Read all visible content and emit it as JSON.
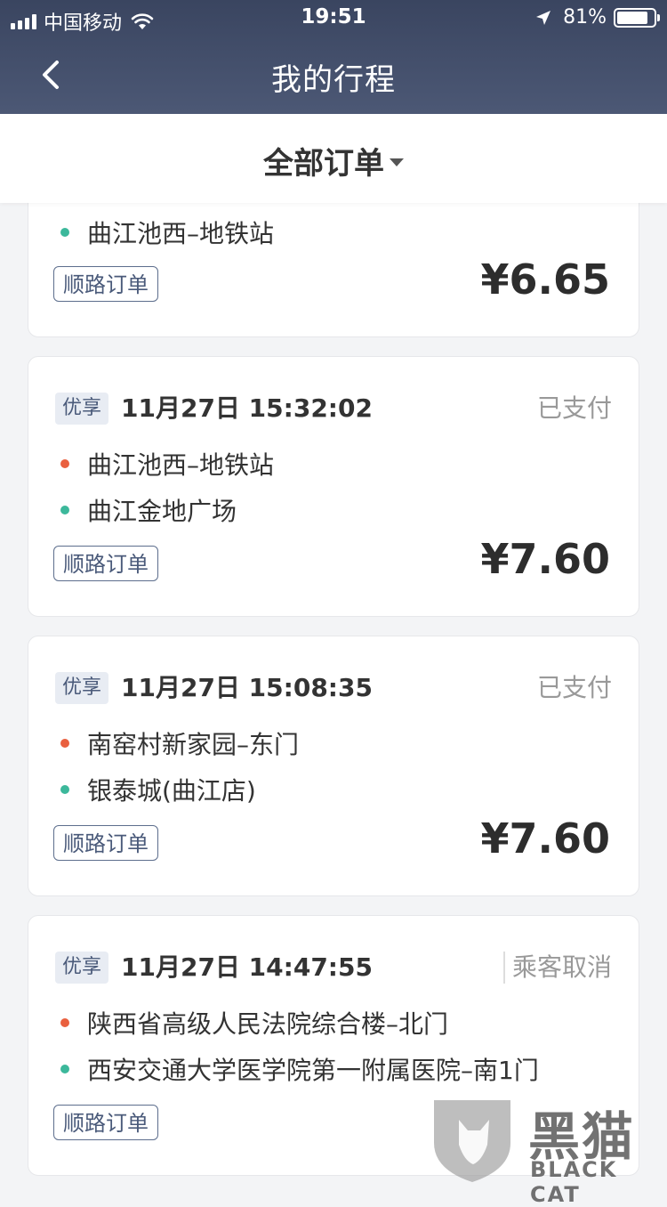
{
  "status_bar": {
    "carrier": "中国移动",
    "time": "19:51",
    "battery": "81%"
  },
  "nav": {
    "title": "我的行程"
  },
  "filter": {
    "label": "全部订单"
  },
  "orders": [
    {
      "stops": [
        "曲江池西–地铁站"
      ],
      "route_tag": "顺路订单",
      "price": "¥6.65"
    },
    {
      "tag": "优享",
      "time": "11月27日 15:32:02",
      "status": "已支付",
      "stops": [
        "曲江池西–地铁站",
        "曲江金地广场"
      ],
      "route_tag": "顺路订单",
      "price": "¥7.60"
    },
    {
      "tag": "优享",
      "time": "11月27日 15:08:35",
      "status": "已支付",
      "stops": [
        "南窑村新家园–东门",
        "银泰城(曲江店)"
      ],
      "route_tag": "顺路订单",
      "price": "¥7.60"
    },
    {
      "tag": "优享",
      "time": "11月27日 14:47:55",
      "status": "乘客取消",
      "stops": [
        "陕西省高级人民法院综合楼–北门",
        "西安交通大学医学院第一附属医院–南1门"
      ],
      "route_tag": "顺路订单"
    }
  ],
  "watermark": {
    "cn": "黑猫",
    "en": "BLACK CAT"
  },
  "colors": {
    "header": "#3a4560",
    "start_dot": "#e9603f",
    "end_dot": "#3cb89b",
    "tag_blue": "#4a5a7a"
  },
  "icons": {
    "back": "chevron-left-icon",
    "wifi": "wifi-icon",
    "location": "location-arrow-icon",
    "battery": "battery-icon",
    "dropdown": "caret-down-icon"
  }
}
